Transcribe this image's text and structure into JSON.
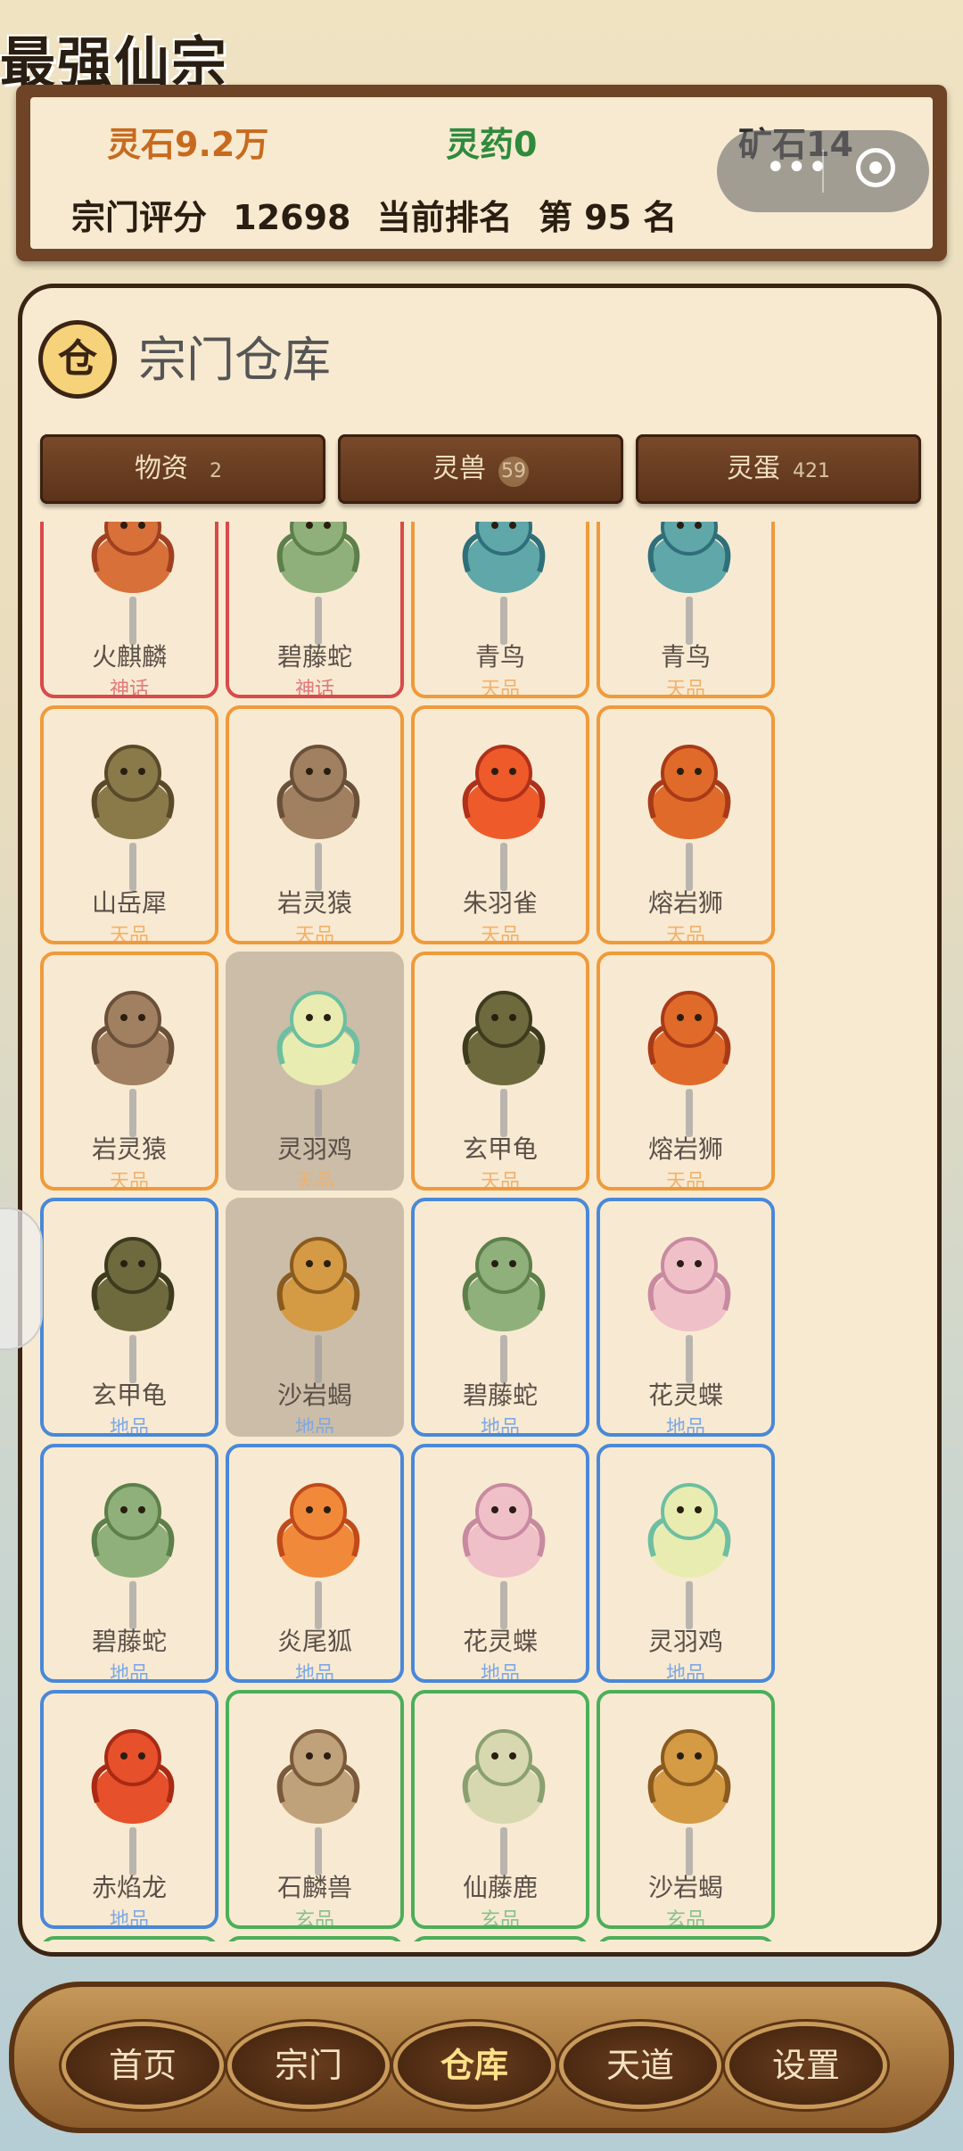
{
  "app_title": "最强仙宗",
  "resources": {
    "spirit_stone": "灵石9.2万",
    "spirit_herb": "灵药0",
    "ore": "矿石14"
  },
  "ranking": {
    "score_label": "宗门评分",
    "score_value": "12698",
    "rank_label": "当前排名",
    "rank_value": "第 95 名"
  },
  "warehouse": {
    "icon_char": "仓",
    "title": "宗门仓库",
    "tabs": [
      {
        "label": "物资",
        "count": "2"
      },
      {
        "label": "灵兽",
        "count": "59"
      },
      {
        "label": "灵蛋",
        "count": "421"
      }
    ],
    "cards": [
      {
        "name": "火麒麟",
        "tier": "神话",
        "tier_key": "myth",
        "icon": "qilin-icon"
      },
      {
        "name": "碧藤蛇",
        "tier": "神话",
        "tier_key": "myth",
        "icon": "vine-snake-icon"
      },
      {
        "name": "青鸟",
        "tier": "天品",
        "tier_key": "heaven",
        "icon": "azure-bird-icon"
      },
      {
        "name": "青鸟",
        "tier": "天品",
        "tier_key": "heaven",
        "icon": "azure-bird-icon"
      },
      {
        "name": "山岳犀",
        "tier": "天品",
        "tier_key": "heaven",
        "icon": "rhino-icon"
      },
      {
        "name": "岩灵猿",
        "tier": "天品",
        "tier_key": "heaven",
        "icon": "monkey-icon"
      },
      {
        "name": "朱羽雀",
        "tier": "天品",
        "tier_key": "heaven",
        "icon": "phoenix-icon"
      },
      {
        "name": "熔岩狮",
        "tier": "天品",
        "tier_key": "heaven",
        "icon": "lion-icon"
      },
      {
        "name": "岩灵猿",
        "tier": "天品",
        "tier_key": "heaven",
        "icon": "monkey-icon"
      },
      {
        "name": "灵羽鸡",
        "tier": "天品",
        "tier_key": "heaven",
        "icon": "chick-icon",
        "disabled": true
      },
      {
        "name": "玄甲龟",
        "tier": "天品",
        "tier_key": "heaven",
        "icon": "turtle-icon"
      },
      {
        "name": "熔岩狮",
        "tier": "天品",
        "tier_key": "heaven",
        "icon": "lion-icon"
      },
      {
        "name": "玄甲龟",
        "tier": "地品",
        "tier_key": "earth",
        "icon": "turtle-icon"
      },
      {
        "name": "沙岩蝎",
        "tier": "地品",
        "tier_key": "earth",
        "icon": "scorpion-icon",
        "disabled": true
      },
      {
        "name": "碧藤蛇",
        "tier": "地品",
        "tier_key": "earth",
        "icon": "vine-snake-icon"
      },
      {
        "name": "花灵蝶",
        "tier": "地品",
        "tier_key": "earth",
        "icon": "butterfly-icon"
      },
      {
        "name": "碧藤蛇",
        "tier": "地品",
        "tier_key": "earth",
        "icon": "vine-snake-icon"
      },
      {
        "name": "炎尾狐",
        "tier": "地品",
        "tier_key": "earth",
        "icon": "fox-icon"
      },
      {
        "name": "花灵蝶",
        "tier": "地品",
        "tier_key": "earth",
        "icon": "butterfly-icon"
      },
      {
        "name": "灵羽鸡",
        "tier": "地品",
        "tier_key": "earth",
        "icon": "chick-icon"
      },
      {
        "name": "赤焰龙",
        "tier": "地品",
        "tier_key": "earth",
        "icon": "dragon-icon"
      },
      {
        "name": "石麟兽",
        "tier": "玄品",
        "tier_key": "mystic",
        "icon": "stone-lion-icon"
      },
      {
        "name": "仙藤鹿",
        "tier": "玄品",
        "tier_key": "mystic",
        "icon": "deer-icon"
      },
      {
        "name": "沙岩蝎",
        "tier": "玄品",
        "tier_key": "mystic",
        "icon": "scorpion-icon"
      },
      {
        "name": "",
        "tier": "",
        "tier_key": "mystic",
        "icon": "chick-icon"
      },
      {
        "name": "",
        "tier": "",
        "tier_key": "mystic",
        "icon": "azure-bird-icon"
      },
      {
        "name": "",
        "tier": "",
        "tier_key": "mystic",
        "icon": "fox-icon"
      },
      {
        "name": "",
        "tier": "",
        "tier_key": "mystic",
        "icon": "stone-lion-icon"
      }
    ]
  },
  "nav": [
    {
      "label": "首页",
      "active": false
    },
    {
      "label": "宗门",
      "active": false
    },
    {
      "label": "仓库",
      "active": true
    },
    {
      "label": "天道",
      "active": false
    },
    {
      "label": "设置",
      "active": false
    }
  ],
  "colors": {
    "heaven": "#ef9a3a",
    "myth": "#d94a4a",
    "earth": "#4a88d8",
    "mystic": "#4cae5a"
  }
}
